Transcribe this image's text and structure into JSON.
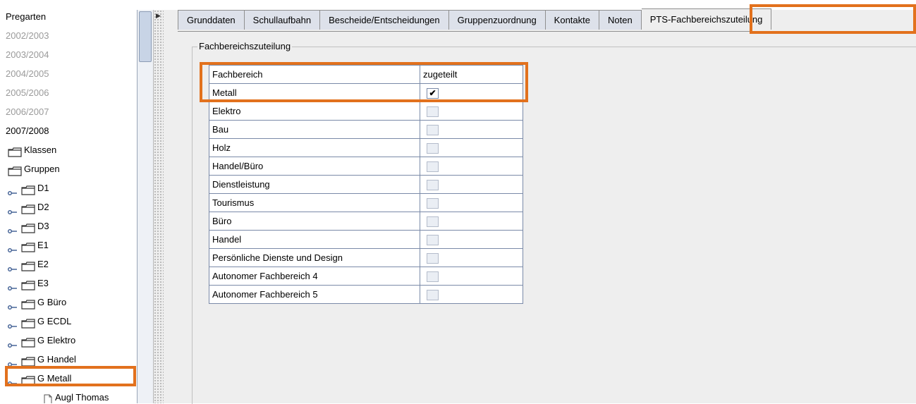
{
  "tree": {
    "items": [
      {
        "label": "Pregarten",
        "grey": false,
        "type": "text"
      },
      {
        "label": "2002/2003",
        "grey": true,
        "type": "text"
      },
      {
        "label": "2003/2004",
        "grey": true,
        "type": "text"
      },
      {
        "label": "2004/2005",
        "grey": true,
        "type": "text"
      },
      {
        "label": "2005/2006",
        "grey": true,
        "type": "text"
      },
      {
        "label": "2006/2007",
        "grey": true,
        "type": "text"
      },
      {
        "label": "2007/2008",
        "grey": false,
        "type": "text"
      },
      {
        "label": "Klassen",
        "type": "folder"
      },
      {
        "label": "Gruppen",
        "type": "folder"
      },
      {
        "label": "D1",
        "type": "group"
      },
      {
        "label": "D2",
        "type": "group"
      },
      {
        "label": "D3",
        "type": "group"
      },
      {
        "label": "E1",
        "type": "group"
      },
      {
        "label": "E2",
        "type": "group"
      },
      {
        "label": "E3",
        "type": "group"
      },
      {
        "label": "G Büro",
        "type": "group"
      },
      {
        "label": "G ECDL",
        "type": "group"
      },
      {
        "label": "G Elektro",
        "type": "group"
      },
      {
        "label": "G Handel",
        "type": "group"
      },
      {
        "label": "G Metall",
        "type": "group"
      },
      {
        "label": "Augl Thomas",
        "type": "doc"
      }
    ]
  },
  "tabs": [
    {
      "label": "Grunddaten",
      "active": false
    },
    {
      "label": "Schullaufbahn",
      "active": false
    },
    {
      "label": "Bescheide/Entscheidungen",
      "active": false
    },
    {
      "label": "Gruppenzuordnung",
      "active": false
    },
    {
      "label": "Kontakte",
      "active": false
    },
    {
      "label": "Noten",
      "active": false
    },
    {
      "label": "PTS-Fachbereichszuteilung",
      "active": true
    }
  ],
  "panel": {
    "group_title": "Fachbereichszuteilung",
    "table": {
      "headers": [
        "Fachbereich",
        "zugeteilt"
      ],
      "rows": [
        {
          "name": "Metall",
          "checked": true
        },
        {
          "name": "Elektro",
          "checked": false
        },
        {
          "name": "Bau",
          "checked": false
        },
        {
          "name": "Holz",
          "checked": false
        },
        {
          "name": "Handel/Büro",
          "checked": false
        },
        {
          "name": "Dienstleistung",
          "checked": false
        },
        {
          "name": "Tourismus",
          "checked": false
        },
        {
          "name": "Büro",
          "checked": false
        },
        {
          "name": "Handel",
          "checked": false
        },
        {
          "name": "Persönliche Dienste und Design",
          "checked": false
        },
        {
          "name": "Autonomer Fachbereich 4",
          "checked": false
        },
        {
          "name": "Autonomer Fachbereich 5",
          "checked": false
        }
      ]
    }
  },
  "colors": {
    "highlight": "#e2711d",
    "table_border": "#7a8aa8",
    "panel_bg": "#eeeeee"
  },
  "icons": {
    "folder": "folder-icon",
    "tree_handle": "tree-key-icon",
    "leaf": "document-icon",
    "check": "✔"
  }
}
